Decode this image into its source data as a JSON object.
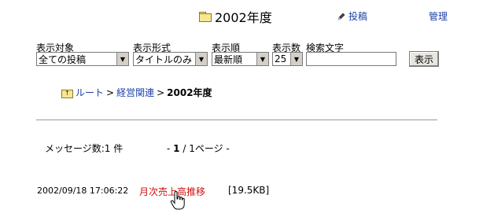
{
  "header": {
    "title": "2002年度",
    "post_label": "投稿",
    "manage_label": "管理"
  },
  "filters": {
    "target_label": "表示対象",
    "target_value": "全ての投稿",
    "format_label": "表示形式",
    "format_value": "タイトルのみ",
    "order_label": "表示順",
    "order_value": "最新順",
    "count_label": "表示数",
    "count_value": "25",
    "search_label": "検索文字",
    "search_value": "",
    "display_button": "表示"
  },
  "breadcrumb": {
    "root": "ルート",
    "sep1": ">",
    "mid": "経営関連",
    "sep2": ">",
    "current": "2002年度"
  },
  "summary": {
    "message_count": "メッセージ数:1 件",
    "pager_prefix": "- ",
    "pager_page": "1",
    "pager_suffix": " / 1ページ -"
  },
  "messages": [
    {
      "date": "2002/09/18 17:06:22",
      "title": "月次売上高推移",
      "size": "[19.5KB]"
    }
  ],
  "icons": {
    "folder": "folder-icon",
    "pencil": "pencil-icon",
    "up_folder": "up-folder-icon",
    "cursor": "hand-cursor-icon"
  },
  "colors": {
    "link": "#1a3fa8",
    "message_title": "#cc1111"
  }
}
